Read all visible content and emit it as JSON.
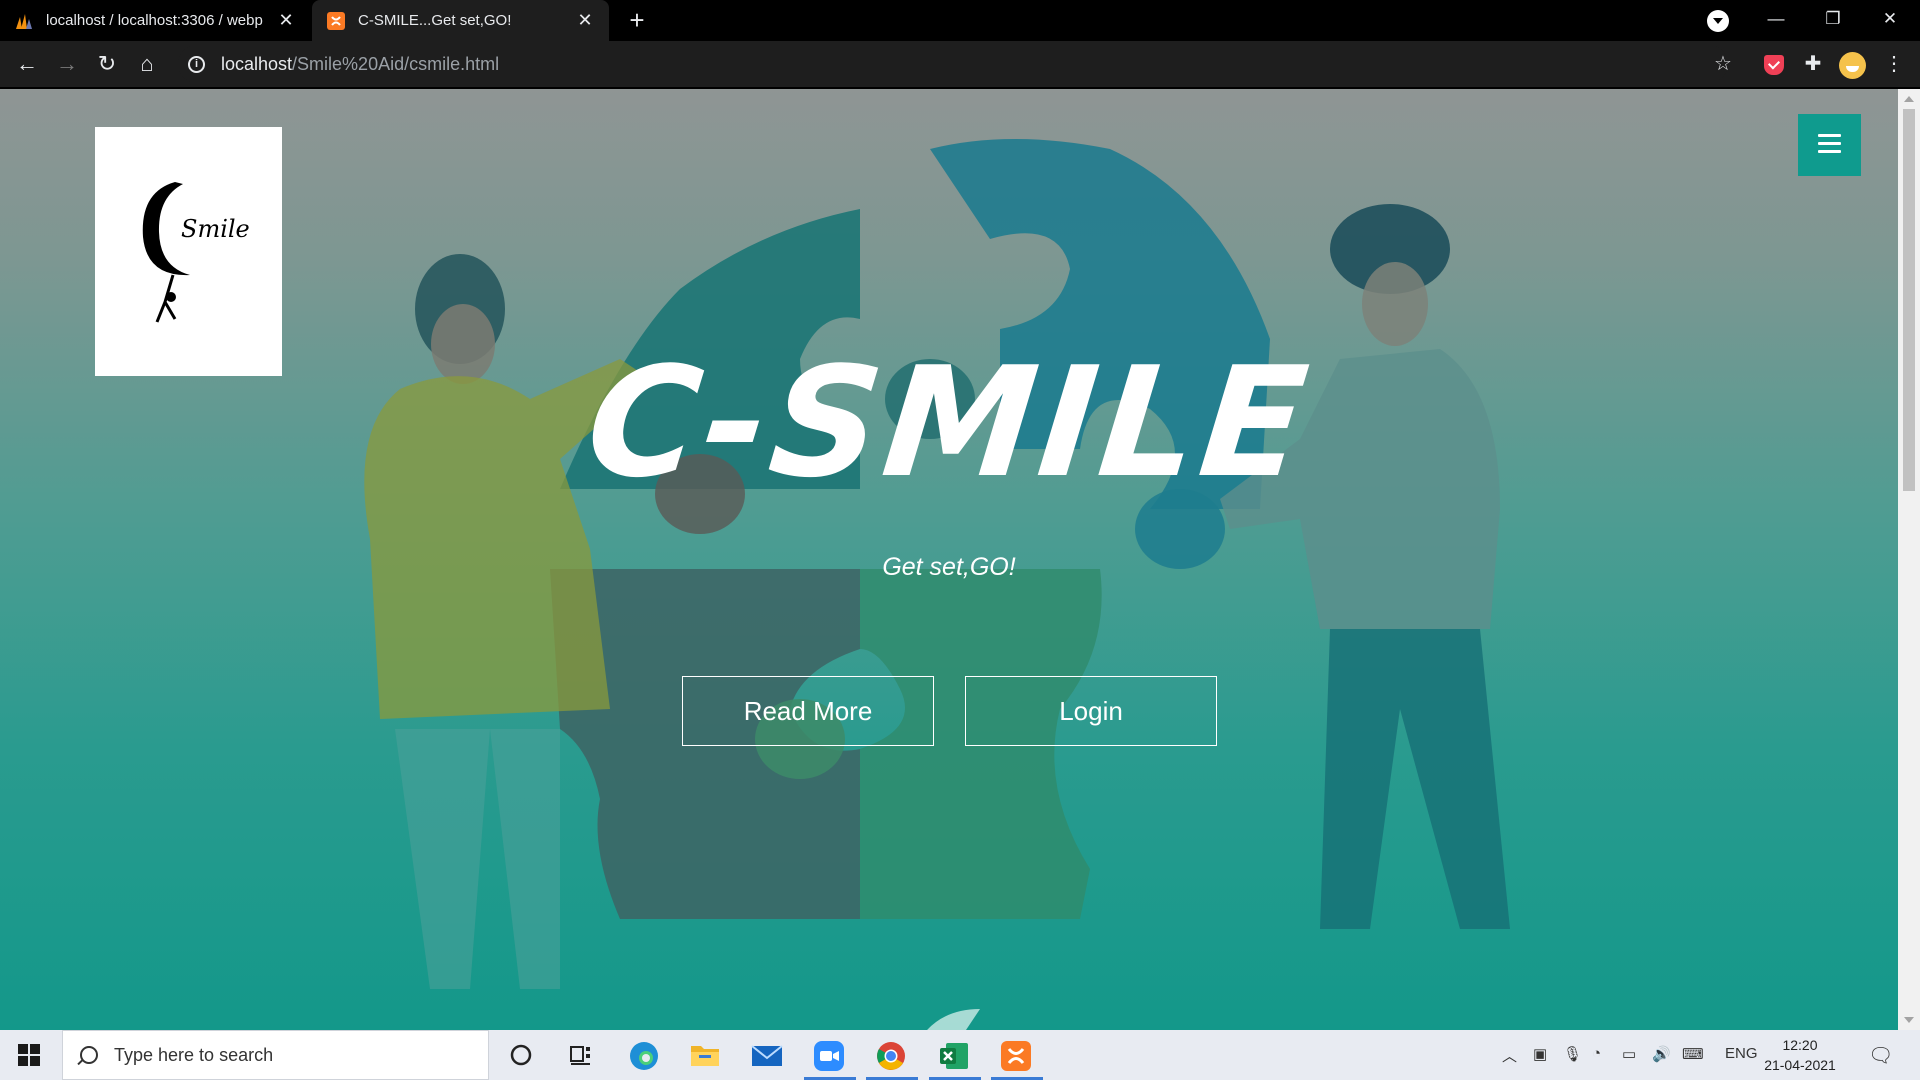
{
  "browser": {
    "tabs": [
      {
        "title": "localhost / localhost:3306 / webp",
        "active": false
      },
      {
        "title": "C-SMILE...Get set,GO!",
        "active": true
      }
    ],
    "address": {
      "host": "localhost",
      "path": "/Smile%20Aid/csmile.html"
    }
  },
  "page": {
    "logo_text": "Smile",
    "hero_title": "C-SMILE",
    "hero_subtitle": "Get set,GO!",
    "buttons": {
      "read_more": "Read More",
      "login": "Login"
    },
    "colors": {
      "accent": "#0f9b8e",
      "hero_text": "#ffffff"
    }
  },
  "taskbar": {
    "search_placeholder": "Type here to search",
    "language": "ENG",
    "time": "12:20",
    "date": "21-04-2021"
  }
}
